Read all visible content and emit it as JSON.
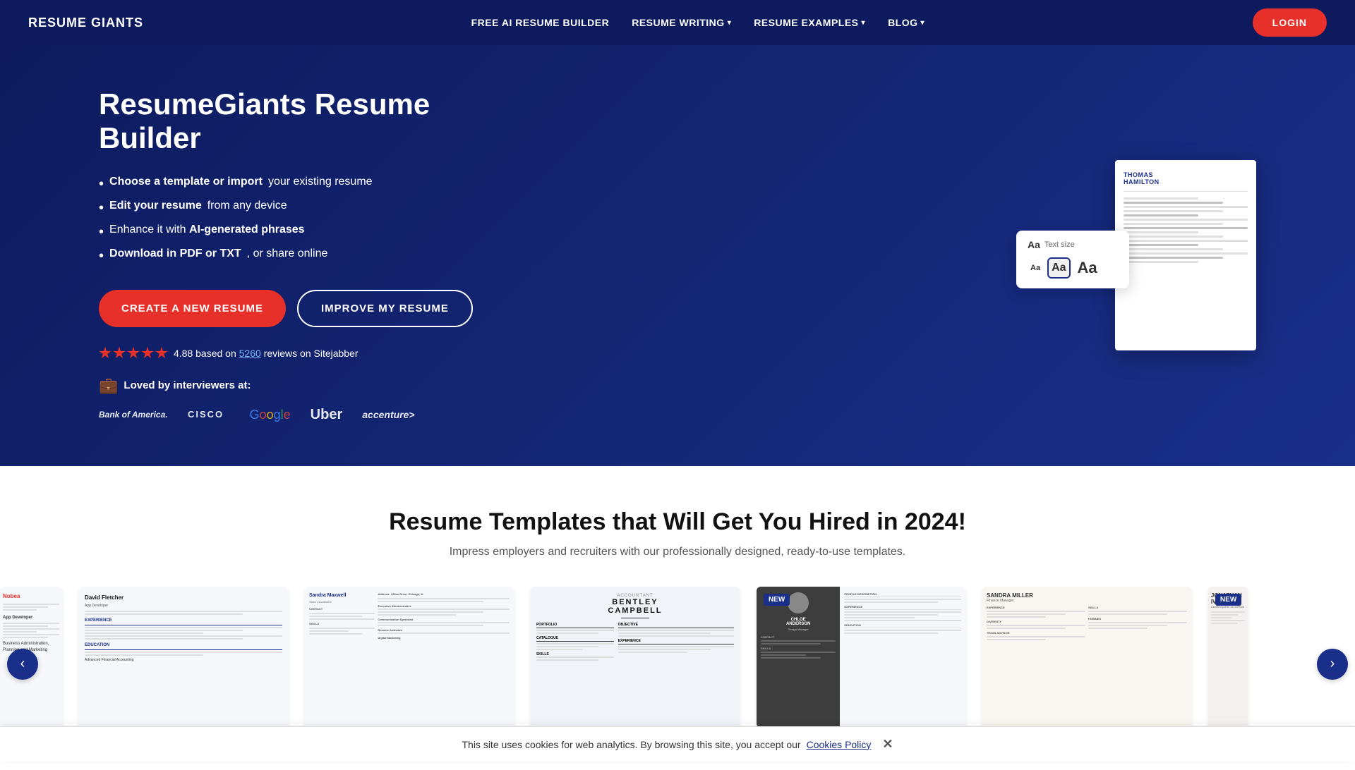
{
  "brand": {
    "name": "RESUME GIANTS"
  },
  "nav": {
    "links": [
      {
        "label": "FREE AI RESUME BUILDER",
        "hasDropdown": false
      },
      {
        "label": "RESUME WRITING",
        "hasDropdown": true
      },
      {
        "label": "RESUME EXAMPLES",
        "hasDropdown": true
      },
      {
        "label": "BLOG",
        "hasDropdown": true
      }
    ],
    "login_label": "LOGIN"
  },
  "hero": {
    "title": "ResumeGiants Resume Builder",
    "bullets": [
      {
        "prefix": "Choose a template or import",
        "text": " your existing resume"
      },
      {
        "prefix": "Edit your resume",
        "text": " from any device"
      },
      {
        "prefix": "Enhance it with ",
        "bold": "AI-generated phrases",
        "text": ""
      },
      {
        "prefix": "Download in PDF or TXT",
        "text": ", or share online"
      }
    ],
    "cta_create": "CREATE A NEW RESUME",
    "cta_improve": "IMPROVE MY RESUME",
    "rating_score": "4.88",
    "rating_text": "based on",
    "rating_count": "5260",
    "rating_platform": "reviews on Sitejabber",
    "loved_by_label": "Loved by interviewers at:",
    "companies": [
      "Bank of America",
      "CISCO",
      "Google",
      "Uber",
      "accenture"
    ],
    "resume_name": "THOMAS\nHAMILTON",
    "text_size_label": "Text size",
    "text_size_options": [
      "Aa",
      "Aa",
      "Aa"
    ]
  },
  "templates": {
    "title": "Resume Templates that Will Get You Hired in 2024!",
    "subtitle": "Impress employers and recruiters with our professionally designed, ready-to-use templates.",
    "items": [
      {
        "name": "David Fletcher",
        "title": "App Developer",
        "isNew": false
      },
      {
        "name": "Sandra Maxwell",
        "title": "Sales Coordinator",
        "isNew": false
      },
      {
        "name": "BENTLEY CAMPBELL",
        "title": "Accountant",
        "isNew": false
      },
      {
        "name": "CHLOE ANDERSON",
        "title": "Design Manager",
        "isNew": true
      },
      {
        "name": "SANDRA MILLER",
        "title": "Finance Manager",
        "isNew": false
      },
      {
        "name": "JONATHAN IVERS",
        "title": "Public Accountant",
        "isNew": true
      }
    ]
  },
  "cookie": {
    "text": "This site uses cookies for web analytics. By browsing this site, you accept our",
    "link_text": "Cookies Policy",
    "close_label": "✕"
  }
}
